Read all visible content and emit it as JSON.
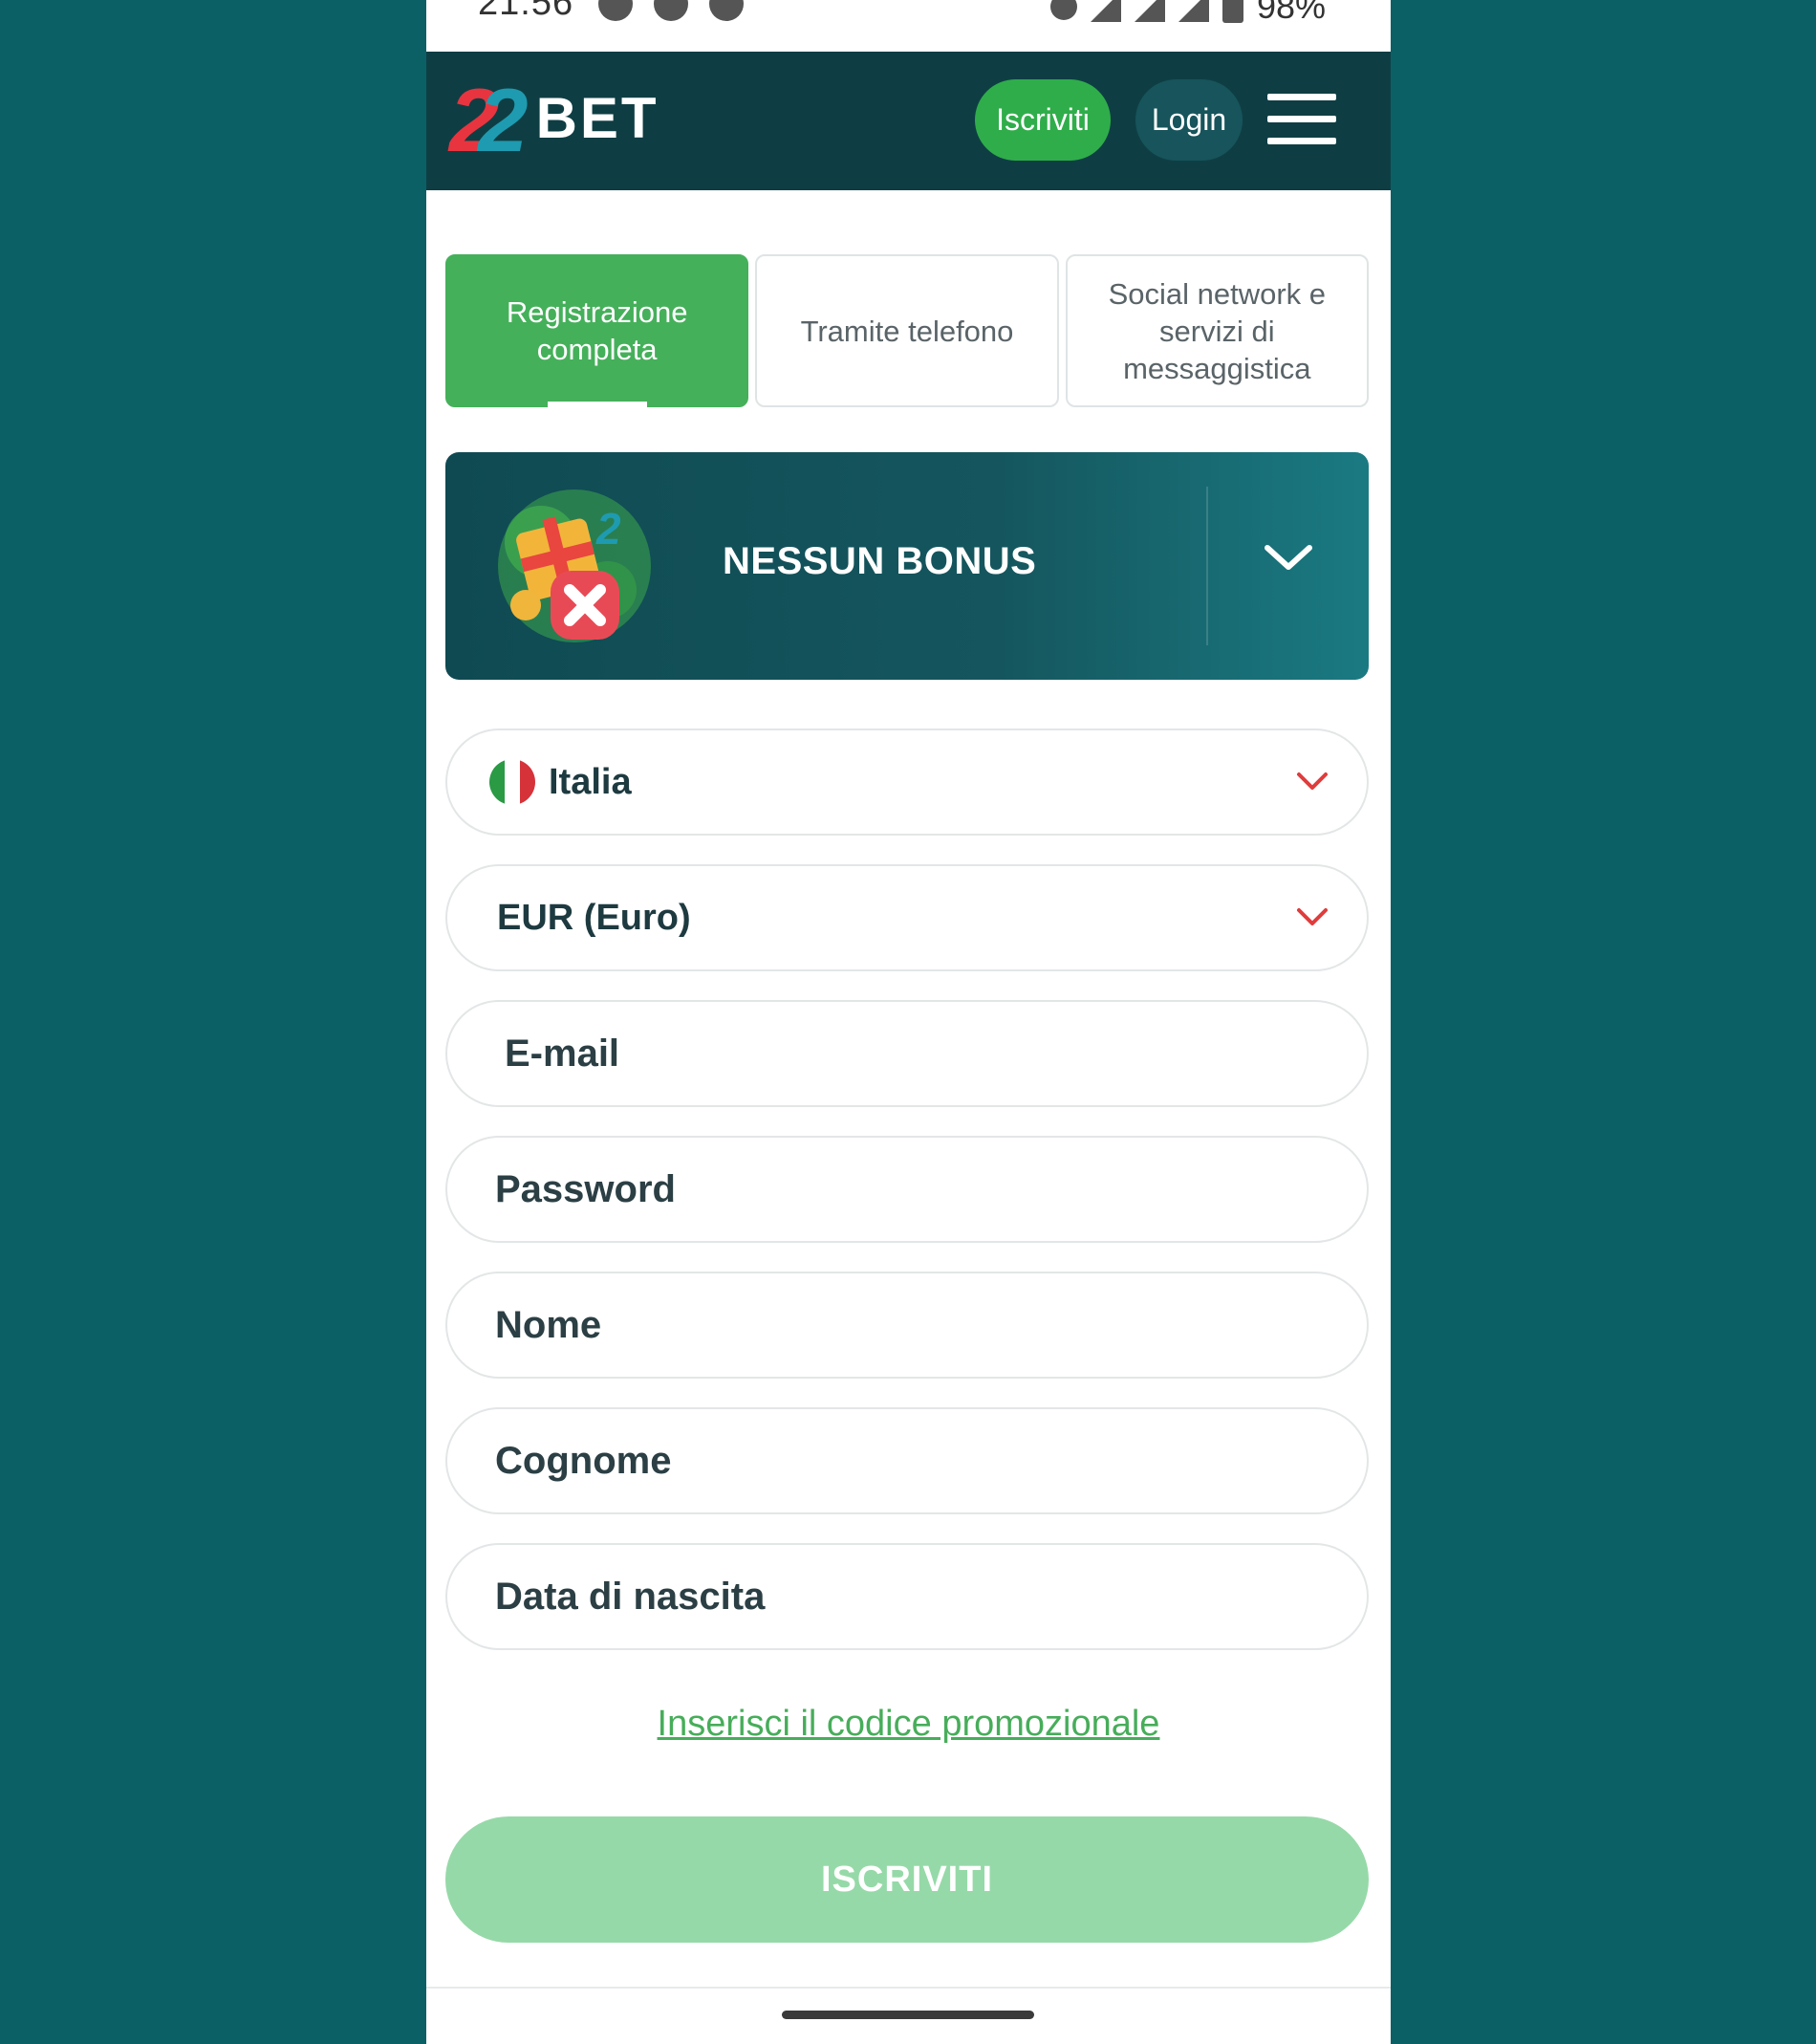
{
  "status_bar": {
    "time": "21:56",
    "battery": "98%"
  },
  "header": {
    "logo_digits": [
      "2",
      "2"
    ],
    "logo_word": "BET",
    "register_label": "Iscriviti",
    "login_label": "Login"
  },
  "tabs": [
    {
      "label": "Registrazione completa",
      "active": true
    },
    {
      "label": "Tramite telefono",
      "active": false
    },
    {
      "label": "Social network e servizi di messaggistica",
      "active": false
    }
  ],
  "bonus": {
    "title": "NESSUN BONUS"
  },
  "form": {
    "country": {
      "value": "Italia"
    },
    "currency": {
      "value": "EUR (Euro)"
    },
    "email": {
      "placeholder": "E-mail"
    },
    "password": {
      "placeholder": "Password"
    },
    "first_name": {
      "placeholder": "Nome"
    },
    "last_name": {
      "placeholder": "Cognome"
    },
    "birth_date": {
      "placeholder": "Data di nascita"
    },
    "promo_link": "Inserisci il codice promozionale",
    "submit_label": "ISCRIVITI"
  },
  "colors": {
    "page_background": "#0b6066",
    "header_background": "#0e3e44",
    "brand_green": "#2fad4a",
    "submit_disabled": "#96d9a8",
    "dropdown_chevron": "#e03c3c",
    "flag": [
      "#2a9a45",
      "#ffffff",
      "#d6323a"
    ]
  }
}
